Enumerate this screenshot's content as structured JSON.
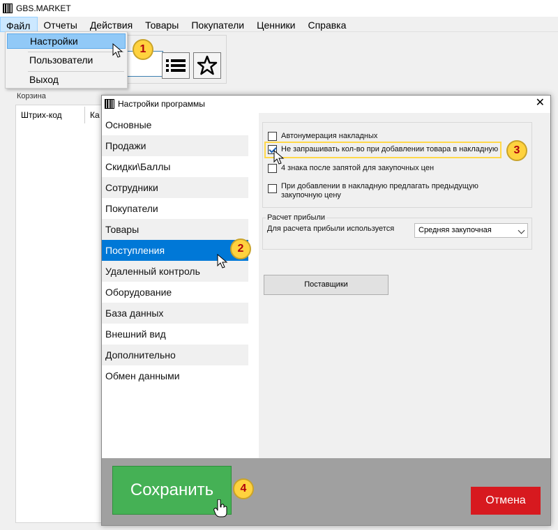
{
  "app": {
    "title": "GBS.MARKET"
  },
  "menu": [
    {
      "label": "Файл",
      "active": true
    },
    {
      "label": "Отчеты"
    },
    {
      "label": "Действия"
    },
    {
      "label": "Товары"
    },
    {
      "label": "Покупатели"
    },
    {
      "label": "Ценники"
    },
    {
      "label": "Справка"
    }
  ],
  "file_menu": {
    "items": [
      "Настройки",
      "Пользователи",
      "Выход"
    ],
    "highlighted": "Настройки"
  },
  "toolbar": {
    "icons": [
      "list-icon",
      "star-icon"
    ]
  },
  "cart": {
    "label": "Корзина",
    "columns": [
      "Штрих-код",
      "Ка"
    ]
  },
  "dialog": {
    "title": "Настройки программы",
    "nav": [
      "Основные",
      "Продажи",
      "Скидки\\Баллы",
      "Сотрудники",
      "Покупатели",
      "Товары",
      "Поступления",
      "Удаленный контроль",
      "Оборудование",
      "База данных",
      "Внешний вид",
      "Дополнительно",
      "Обмен данными"
    ],
    "selected_nav": "Поступления",
    "options": {
      "auto_numbering": {
        "label": "Автонумерация накладных",
        "checked": false
      },
      "no_qty_prompt": {
        "label": "Не запрашивать кол-во при добавлении товара в накладную",
        "checked": true
      },
      "four_digits": {
        "label": "4 знака после запятой для закупочных цен",
        "checked": false
      },
      "suggest_prev_price": {
        "label": "При добавлении в накладную предлагать предыдущую закупочную цену",
        "checked": false
      }
    },
    "profit": {
      "group_label": "Расчет прибыли",
      "field_label": "Для расчета прибыли используется",
      "selected_value": "Средняя закупочная"
    },
    "suppliers_button": "Поставщики",
    "save_button": "Сохранить",
    "cancel_button": "Отмена"
  },
  "badges": [
    "1",
    "2",
    "3",
    "4"
  ],
  "colors": {
    "selection": "#0078d7",
    "save": "#45b155",
    "cancel": "#d7191f",
    "badge": "#ffd23e",
    "footer": "#a0a0a0"
  }
}
